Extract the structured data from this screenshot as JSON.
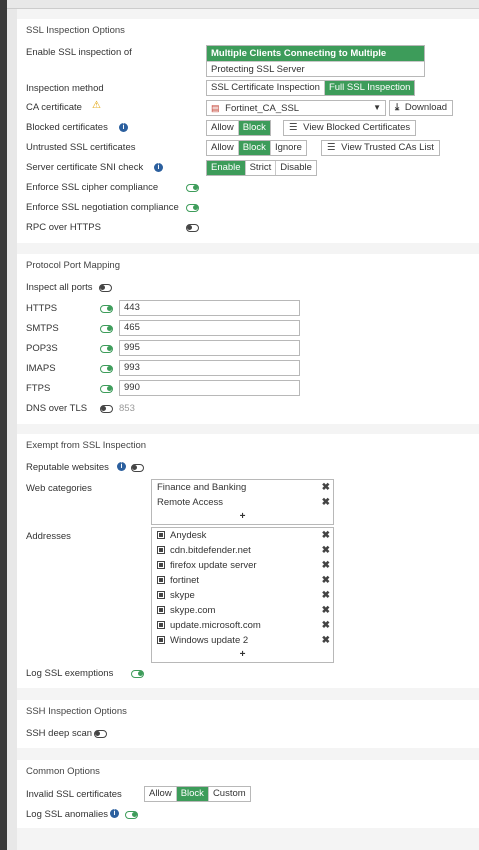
{
  "ssl": {
    "title": "SSL Inspection Options",
    "enable_label": "Enable SSL inspection of",
    "enable_options": [
      "Multiple Clients Connecting to Multiple Servers",
      "Protecting SSL Server"
    ],
    "method_label": "Inspection method",
    "method_options": [
      "SSL Certificate Inspection",
      "Full SSL Inspection"
    ],
    "ca_label": "CA certificate",
    "ca_value": "Fortinet_CA_SSL",
    "download_label": "Download",
    "blocked_label": "Blocked certificates",
    "blocked_options": [
      "Allow",
      "Block"
    ],
    "view_blocked_label": "View Blocked Certificates",
    "untrusted_label": "Untrusted SSL certificates",
    "untrusted_options": [
      "Allow",
      "Block",
      "Ignore"
    ],
    "view_trusted_label": "View Trusted CAs List",
    "sni_label": "Server certificate SNI check",
    "sni_options": [
      "Enable",
      "Strict",
      "Disable"
    ],
    "cipher_label": "Enforce SSL cipher compliance",
    "negotiation_label": "Enforce SSL negotiation compliance",
    "rpc_label": "RPC over HTTPS"
  },
  "ports": {
    "title": "Protocol Port Mapping",
    "inspect_all_label": "Inspect all ports",
    "rows": [
      {
        "label": "HTTPS",
        "value": "443"
      },
      {
        "label": "SMTPS",
        "value": "465"
      },
      {
        "label": "POP3S",
        "value": "995"
      },
      {
        "label": "IMAPS",
        "value": "993"
      },
      {
        "label": "FTPS",
        "value": "990"
      }
    ],
    "dns_label": "DNS over TLS",
    "dns_value": "853"
  },
  "exempt": {
    "title": "Exempt from SSL Inspection",
    "reputable_label": "Reputable websites",
    "webcat_label": "Web categories",
    "webcats": [
      "Finance and Banking",
      "Remote Access"
    ],
    "addresses_label": "Addresses",
    "addresses": [
      "Anydesk",
      "cdn.bitdefender.net",
      "firefox update server",
      "fortinet",
      "skype",
      "skype.com",
      "update.microsoft.com",
      "Windows update 2"
    ],
    "plus": "+",
    "remove": "✖",
    "log_label": "Log SSL exemptions"
  },
  "ssh": {
    "title": "SSH Inspection Options",
    "deep_scan_label": "SSH deep scan"
  },
  "common": {
    "title": "Common Options",
    "invalid_label": "Invalid SSL certificates",
    "invalid_options": [
      "Allow",
      "Block",
      "Custom"
    ],
    "anomalies_label": "Log SSL anomalies"
  },
  "colors": {
    "accent": "#3d9c5a",
    "info": "#2b5f9e",
    "warning": "#e0a000"
  }
}
